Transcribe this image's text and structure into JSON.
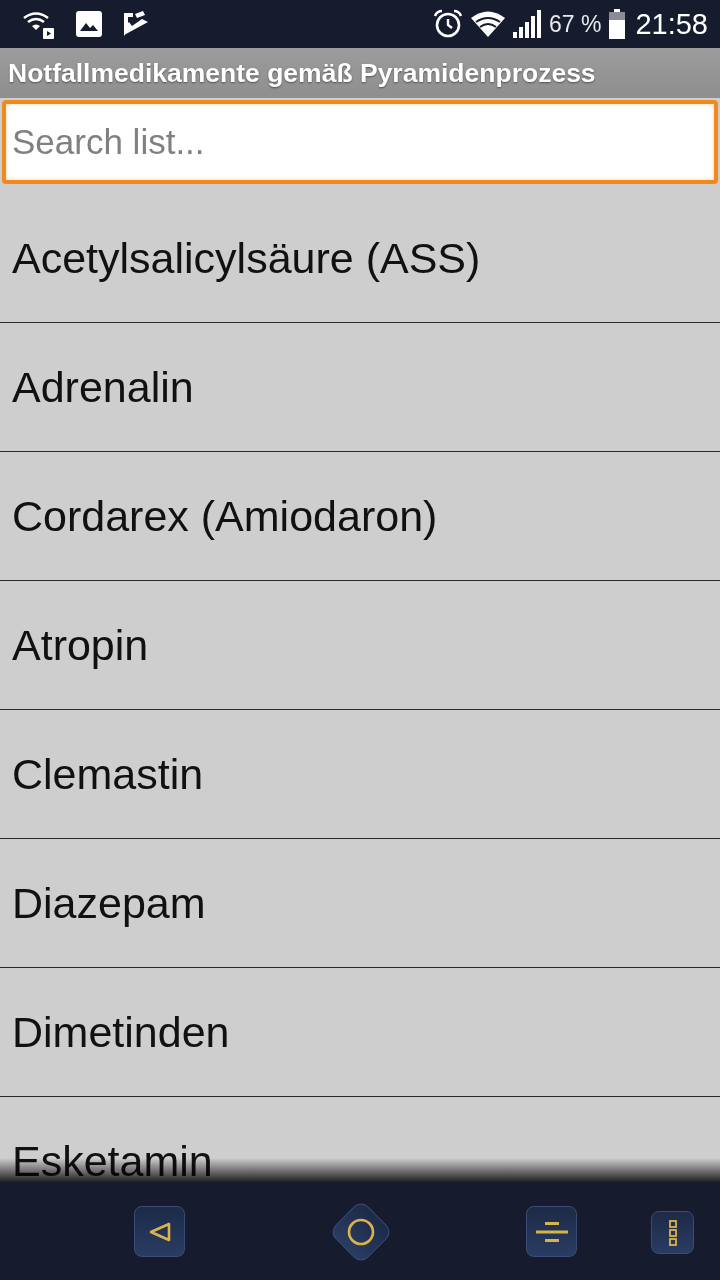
{
  "status_bar": {
    "battery_percent": "67 %",
    "time": "21:58"
  },
  "title_bar": {
    "title": "Notfallmedikamente gemäß Pyramidenprozess"
  },
  "search": {
    "placeholder": "Search list...",
    "focused": true
  },
  "list": {
    "items": [
      {
        "label": "Acetylsalicylsäure (ASS)"
      },
      {
        "label": "Adrenalin"
      },
      {
        "label": "Cordarex (Amiodaron)"
      },
      {
        "label": "Atropin"
      },
      {
        "label": "Clemastin"
      },
      {
        "label": "Diazepam"
      },
      {
        "label": "Dimetinden"
      },
      {
        "label": "Esketamin"
      }
    ]
  }
}
